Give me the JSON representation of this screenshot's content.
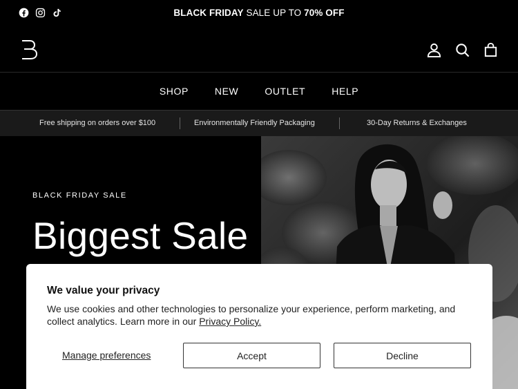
{
  "announcement": {
    "social": [
      {
        "icon": "facebook-icon"
      },
      {
        "icon": "instagram-icon"
      },
      {
        "icon": "tiktok-icon"
      }
    ],
    "promo_bold_1": "BLACK FRIDAY",
    "promo_regular": " SALE UP TO ",
    "promo_bold_2": "70% OFF"
  },
  "header": {
    "logo_icon": "brand-b-logo",
    "icons": [
      "account-icon",
      "search-icon",
      "cart-bag-icon"
    ]
  },
  "nav": {
    "items": [
      "SHOP",
      "NEW",
      "OUTLET",
      "HELP"
    ]
  },
  "usp": {
    "items": [
      "Free shipping on orders over $100",
      "Environmentally Friendly Packaging",
      "30-Day Returns & Exchanges"
    ]
  },
  "hero": {
    "kicker": "BLACK FRIDAY SALE",
    "title": "Biggest Sale"
  },
  "cookie": {
    "title": "We value your privacy",
    "text": "We use cookies and other technologies to personalize your experience, perform marketing, and collect analytics. Learn more in our ",
    "policy_link": "Privacy Policy.",
    "manage_label": "Manage preferences",
    "accept_label": "Accept",
    "decline_label": "Decline"
  }
}
